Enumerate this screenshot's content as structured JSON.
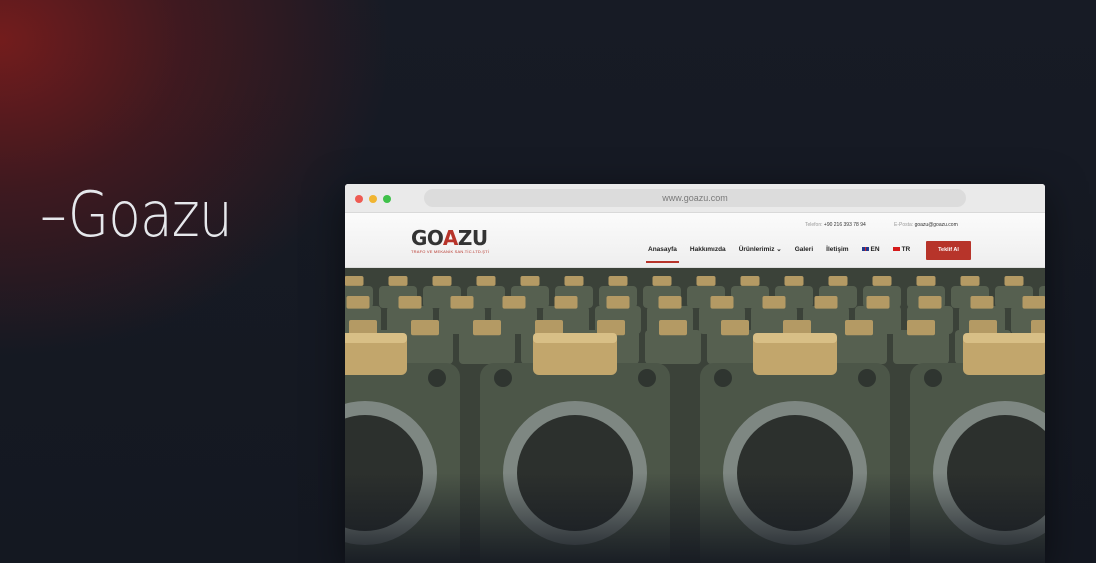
{
  "page": {
    "heading_dash": "–",
    "heading_name": "Goazu"
  },
  "browser": {
    "url": "www.goazu.com"
  },
  "site": {
    "logo": {
      "text_prefix": "GO",
      "text_accent": "A",
      "text_suffix": "ZU",
      "subtitle": "TRAFO VE MEKANİK SAN.TİC.LTD.ŞTİ"
    },
    "contact": {
      "phone_label": "Telefon:",
      "phone": "+90 216 393 78 94",
      "email_label": "E-Posta:",
      "email": "goazu@goazu.com"
    },
    "nav": [
      {
        "label": "Anasayfa",
        "active": true
      },
      {
        "label": "Hakkımızda"
      },
      {
        "label": "Ürünlerimiz ⌄"
      },
      {
        "label": "Galeri"
      },
      {
        "label": "İletişim"
      }
    ],
    "lang_en": "EN",
    "lang_tr": "TR",
    "cta": "Teklif Al"
  },
  "colors": {
    "accent": "#b7342a",
    "background": "#141821"
  },
  "icons": [
    "window-close-dot",
    "window-minimize-dot",
    "window-maximize-dot",
    "uk-flag-icon",
    "tr-flag-icon"
  ]
}
